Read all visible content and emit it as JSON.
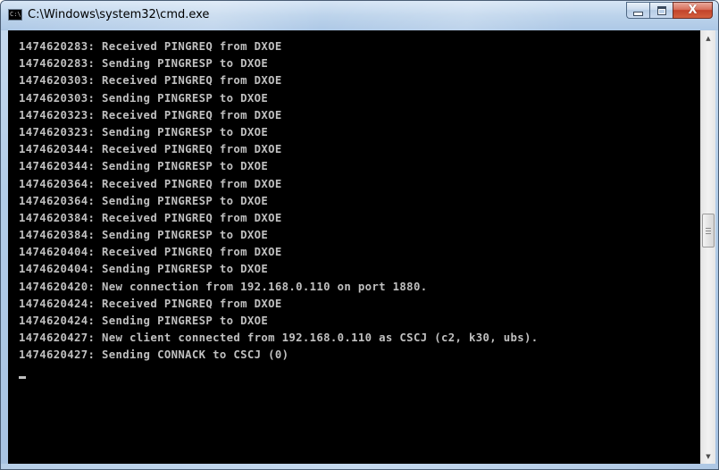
{
  "window": {
    "title": "C:\\Windows\\system32\\cmd.exe",
    "icon_text": "C:\\"
  },
  "controls": {
    "minimize": "minimize",
    "maximize": "maximize",
    "close": "X"
  },
  "console": {
    "lines": [
      "1474620283: Received PINGREQ from DXOE",
      "1474620283: Sending PINGRESP to DXOE",
      "1474620303: Received PINGREQ from DXOE",
      "1474620303: Sending PINGRESP to DXOE",
      "1474620323: Received PINGREQ from DXOE",
      "1474620323: Sending PINGRESP to DXOE",
      "1474620344: Received PINGREQ from DXOE",
      "1474620344: Sending PINGRESP to DXOE",
      "1474620364: Received PINGREQ from DXOE",
      "1474620364: Sending PINGRESP to DXOE",
      "1474620384: Received PINGREQ from DXOE",
      "1474620384: Sending PINGRESP to DXOE",
      "1474620404: Received PINGREQ from DXOE",
      "1474620404: Sending PINGRESP to DXOE",
      "1474620420: New connection from 192.168.0.110 on port 1880.",
      "1474620424: Received PINGREQ from DXOE",
      "1474620424: Sending PINGRESP to DXOE",
      "1474620427: New client connected from 192.168.0.110 as CSCJ (c2, k30, ubs).",
      "1474620427: Sending CONNACK to CSCJ (0)"
    ]
  },
  "scrollbar": {
    "up_arrow": "▲",
    "down_arrow": "▼"
  },
  "colors": {
    "console_bg": "#000000",
    "console_text": "#c0c0c0",
    "titlebar": "#bcd3eb",
    "close_button": "#c7452d"
  }
}
